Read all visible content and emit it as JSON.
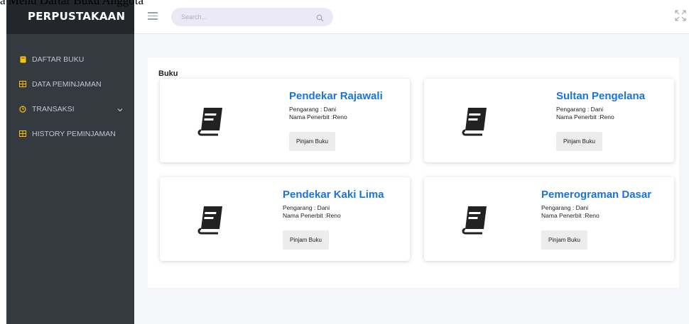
{
  "caption": "a Menu Daftar Buku Anggota",
  "sidebar": {
    "brand": "PERPUSTAKAAN",
    "items": [
      {
        "label": "DAFTAR BUKU",
        "icon": "book-icon"
      },
      {
        "label": "DATA PEMINJAMAN",
        "icon": "table-icon"
      },
      {
        "label": "TRANSAKSI",
        "icon": "clock-icon",
        "has_submenu": true
      },
      {
        "label": "HISTORY PEMINJAMAN",
        "icon": "table-icon"
      }
    ]
  },
  "topbar": {
    "search_placeholder": "Search...",
    "menu_icon": "hamburger-icon",
    "search_icon": "search-icon",
    "fullscreen_icon": "expand-icon"
  },
  "panel": {
    "title": "Buku",
    "books": [
      {
        "title": "Pendekar Rajawali",
        "author": "Pengarang : Dani",
        "publisher": "Nama Penerbit :Reno",
        "button": "Pinjam Buku"
      },
      {
        "title": "Sultan Pengelana",
        "author": "Pengarang : Dani",
        "publisher": "Nama Penerbit :Reno",
        "button": "Pinjam Buku"
      },
      {
        "title": "Pendekar Kaki Lima",
        "author": "Pengarang : Dani",
        "publisher": "Nama Penerbit :Reno",
        "button": "Pinjam Buku"
      },
      {
        "title": "Pemerograman Dasar",
        "author": "Pengarang : Dani",
        "publisher": "Nama Penerbit :Reno",
        "button": "Pinjam Buku"
      }
    ]
  },
  "colors": {
    "sidebar_bg": "#343a40",
    "brand_bg": "#23272b",
    "accent": "#1a73d9",
    "sidebar_icon": "#ffc107"
  }
}
